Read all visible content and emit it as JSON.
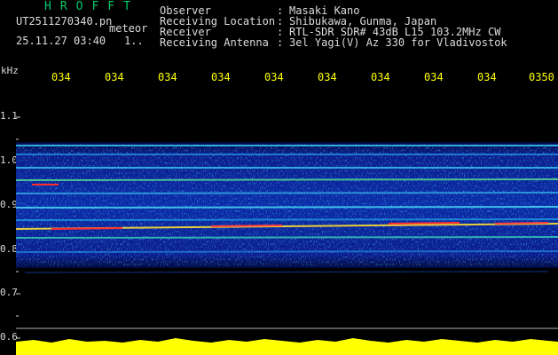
{
  "header": {
    "app_title": "HROFFT",
    "filename": "UT2511270340.pn",
    "suffix": "meteor",
    "datetime": "25.11.27 03:40",
    "counter": "1.."
  },
  "info": [
    {
      "label": "Observer",
      "value": "Masaki Kano"
    },
    {
      "label": "Receiving Location",
      "value": "Shibukawa, Gunma, Japan"
    },
    {
      "label": "Receiver",
      "value": "RTL-SDR SDR# 43dB L15 103.2MHz CW"
    },
    {
      "label": "Receiving Antenna",
      "value": "3el Yagi(V) Az 330 for Vladivostok"
    }
  ],
  "axis": {
    "unit": "kHz",
    "y_ticks": [
      "1.1",
      "1.0",
      "0.9",
      "0.8",
      "0.7",
      "0.6"
    ],
    "x_ticks": [
      "034",
      "034",
      "034",
      "034",
      "034",
      "034",
      "034",
      "034",
      "034",
      "0350"
    ]
  },
  "colors": {
    "background": "#000000",
    "title": "#00cc66",
    "text": "#dcdcdc",
    "time_axis": "#ffff00",
    "spectrum_low": "#0a1a8a",
    "spectrum_mid": "#00c8ff",
    "spectrum_high": "#ff2020",
    "amplitude": "#ffff00"
  }
}
